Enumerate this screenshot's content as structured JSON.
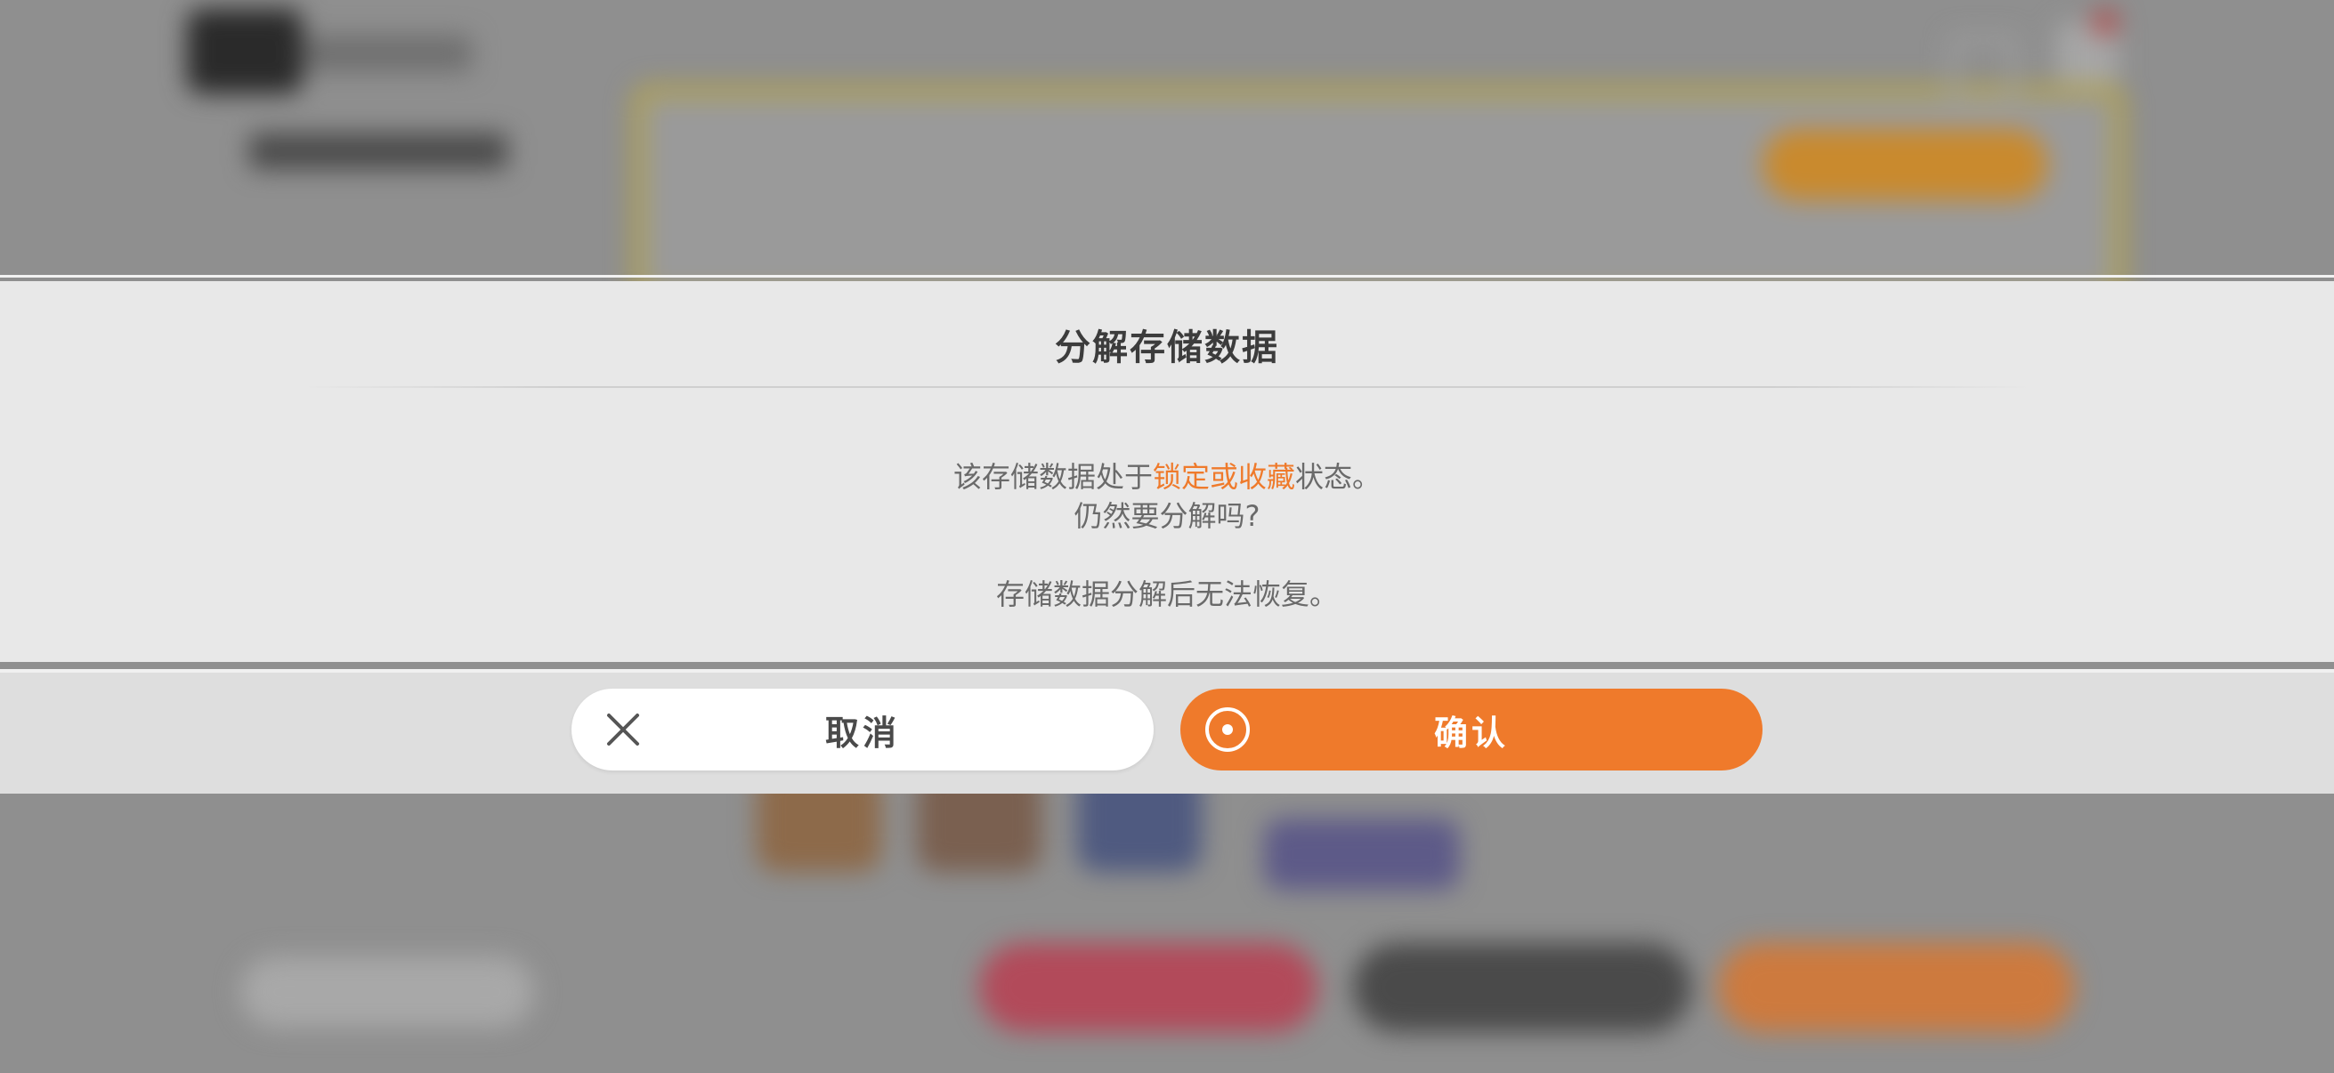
{
  "dialog": {
    "title": "分解存储数据",
    "message_line1_before": "该存储数据处于",
    "message_line1_highlight": "锁定或收藏",
    "message_line1_after": "状态。",
    "message_line2": "仍然要分解吗?",
    "message_line3": "存储数据分解后无法恢复。"
  },
  "buttons": {
    "cancel_label": "取消",
    "confirm_label": "确认",
    "cancel_icon": "close-icon",
    "confirm_icon": "target-icon"
  },
  "colors": {
    "accent": "#ef7a2b",
    "dialog_bg": "#e8e8e8",
    "title_text": "#3c3c3c",
    "body_text": "#6a6a6a"
  }
}
